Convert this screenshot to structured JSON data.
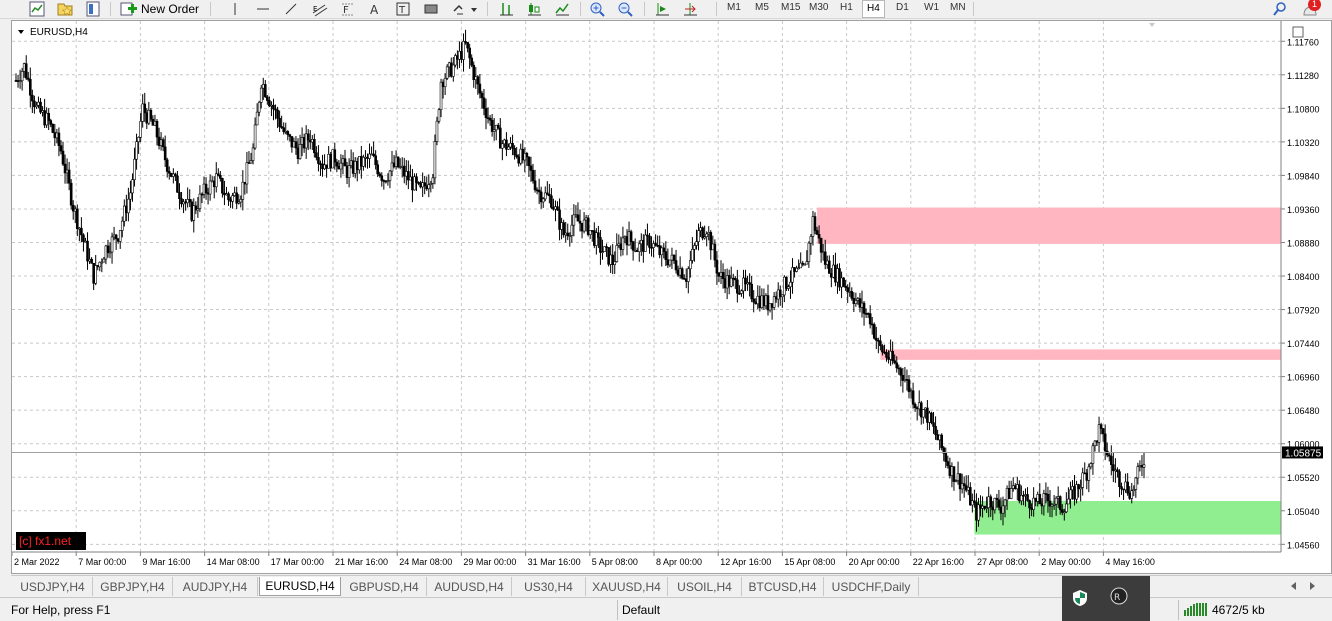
{
  "toolbar": {
    "new_order_label": "New Order",
    "timeframes": [
      "M1",
      "M5",
      "M15",
      "M30",
      "H1",
      "H4",
      "D1",
      "W1",
      "MN"
    ],
    "active_timeframe": "H4",
    "notification_count": "1"
  },
  "chart": {
    "symbol_label": "EURUSD,H4",
    "watermark": "[c] fx1.net",
    "current_price": "1.05875",
    "y_ticks": [
      "1.11760",
      "1.11280",
      "1.10800",
      "1.10320",
      "1.09840",
      "1.09360",
      "1.08880",
      "1.08400",
      "1.07920",
      "1.07440",
      "1.06960",
      "1.06480",
      "1.06000",
      "1.05520",
      "1.05040",
      "1.04560"
    ],
    "x_ticks": [
      "2 Mar 2022",
      "7 Mar 00:00",
      "9 Mar 16:00",
      "14 Mar 08:00",
      "17 Mar 00:00",
      "21 Mar 16:00",
      "24 Mar 08:00",
      "29 Mar 00:00",
      "31 Mar 16:00",
      "5 Apr 08:00",
      "8 Apr 00:00",
      "12 Apr 16:00",
      "15 Apr 08:00",
      "20 Apr 00:00",
      "22 Apr 16:00",
      "27 Apr 08:00",
      "2 May 00:00",
      "4 May 16:00"
    ],
    "colors": {
      "supply_zone": "#ffb6c1",
      "demand_zone": "#90ee90",
      "candle": "#000000",
      "grid": "#c8c8c8",
      "watermark_bg": "#000000",
      "watermark_text": "#ff2020"
    }
  },
  "chart_data": {
    "type": "candlestick",
    "symbol": "EURUSD",
    "timeframe": "H4",
    "ylim": [
      1.0445,
      1.1205
    ],
    "path": [
      [
        0,
        1.112
      ],
      [
        4,
        1.114
      ],
      [
        10,
        1.108
      ],
      [
        16,
        1.106
      ],
      [
        22,
        1.102
      ],
      [
        28,
        1.094
      ],
      [
        34,
        1.088
      ],
      [
        38,
        1.084
      ],
      [
        44,
        1.088
      ],
      [
        50,
        1.09
      ],
      [
        56,
        1.096
      ],
      [
        62,
        1.108
      ],
      [
        68,
        1.105
      ],
      [
        74,
        1.1
      ],
      [
        80,
        1.096
      ],
      [
        86,
        1.093
      ],
      [
        92,
        1.096
      ],
      [
        98,
        1.098
      ],
      [
        104,
        1.095
      ],
      [
        110,
        1.096
      ],
      [
        116,
        1.102
      ],
      [
        120,
        1.112
      ],
      [
        126,
        1.108
      ],
      [
        132,
        1.104
      ],
      [
        138,
        1.102
      ],
      [
        144,
        1.104
      ],
      [
        150,
        1.1
      ],
      [
        156,
        1.101
      ],
      [
        162,
        1.099
      ],
      [
        168,
        1.1
      ],
      [
        174,
        1.101
      ],
      [
        180,
        1.098
      ],
      [
        186,
        1.1
      ],
      [
        192,
        1.098
      ],
      [
        198,
        1.096
      ],
      [
        204,
        1.099
      ],
      [
        208,
        1.112
      ],
      [
        214,
        1.114
      ],
      [
        220,
        1.117
      ],
      [
        226,
        1.111
      ],
      [
        232,
        1.106
      ],
      [
        238,
        1.103
      ],
      [
        244,
        1.102
      ],
      [
        250,
        1.1
      ],
      [
        256,
        1.096
      ],
      [
        262,
        1.095
      ],
      [
        268,
        1.09
      ],
      [
        274,
        1.092
      ],
      [
        280,
        1.091
      ],
      [
        286,
        1.088
      ],
      [
        292,
        1.086
      ],
      [
        298,
        1.09
      ],
      [
        304,
        1.088
      ],
      [
        310,
        1.089
      ],
      [
        316,
        1.087
      ],
      [
        322,
        1.086
      ],
      [
        328,
        1.084
      ],
      [
        334,
        1.09
      ],
      [
        338,
        1.091
      ],
      [
        344,
        1.084
      ],
      [
        350,
        1.083
      ],
      [
        356,
        1.0825
      ],
      [
        362,
        1.081
      ],
      [
        368,
        1.08
      ],
      [
        374,
        1.082
      ],
      [
        380,
        1.084
      ],
      [
        386,
        1.085
      ],
      [
        390,
        1.092
      ],
      [
        396,
        1.086
      ],
      [
        402,
        1.084
      ],
      [
        408,
        1.082
      ],
      [
        412,
        1.08
      ],
      [
        418,
        1.078
      ],
      [
        422,
        1.074
      ],
      [
        428,
        1.072
      ],
      [
        434,
        1.07
      ],
      [
        440,
        1.066
      ],
      [
        446,
        1.064
      ],
      [
        452,
        1.06
      ],
      [
        458,
        1.056
      ],
      [
        464,
        1.054
      ],
      [
        470,
        1.05
      ],
      [
        476,
        1.052
      ],
      [
        482,
        1.051
      ],
      [
        488,
        1.054
      ],
      [
        494,
        1.052
      ],
      [
        500,
        1.0515
      ],
      [
        506,
        1.052
      ],
      [
        512,
        1.051
      ],
      [
        518,
        1.053
      ],
      [
        524,
        1.056
      ],
      [
        530,
        1.062
      ],
      [
        536,
        1.057
      ],
      [
        540,
        1.055
      ],
      [
        546,
        1.053
      ],
      [
        552,
        1.058
      ]
    ],
    "zones": [
      {
        "kind": "supply",
        "x_start": 392,
        "top": 1.0938,
        "bottom": 1.0886
      },
      {
        "kind": "supply",
        "x_start": 423,
        "top": 1.0735,
        "bottom": 1.072
      },
      {
        "kind": "demand",
        "x_start": 469,
        "top": 1.0518,
        "bottom": 1.047
      }
    ]
  },
  "tabs": [
    "USDJPY,H4",
    "GBPJPY,H4",
    "AUDJPY,H4",
    "EURUSD,H4",
    "GBPUSD,H4",
    "AUDUSD,H4",
    "US30,H4",
    "XAUUSD,H4",
    "USOIL,H4",
    "BTCUSD,H4",
    "USDCHF,Daily"
  ],
  "active_tab": "EURUSD,H4",
  "status": {
    "help": "For Help, press F1",
    "profile": "Default",
    "connection": "4672/5 kb"
  }
}
